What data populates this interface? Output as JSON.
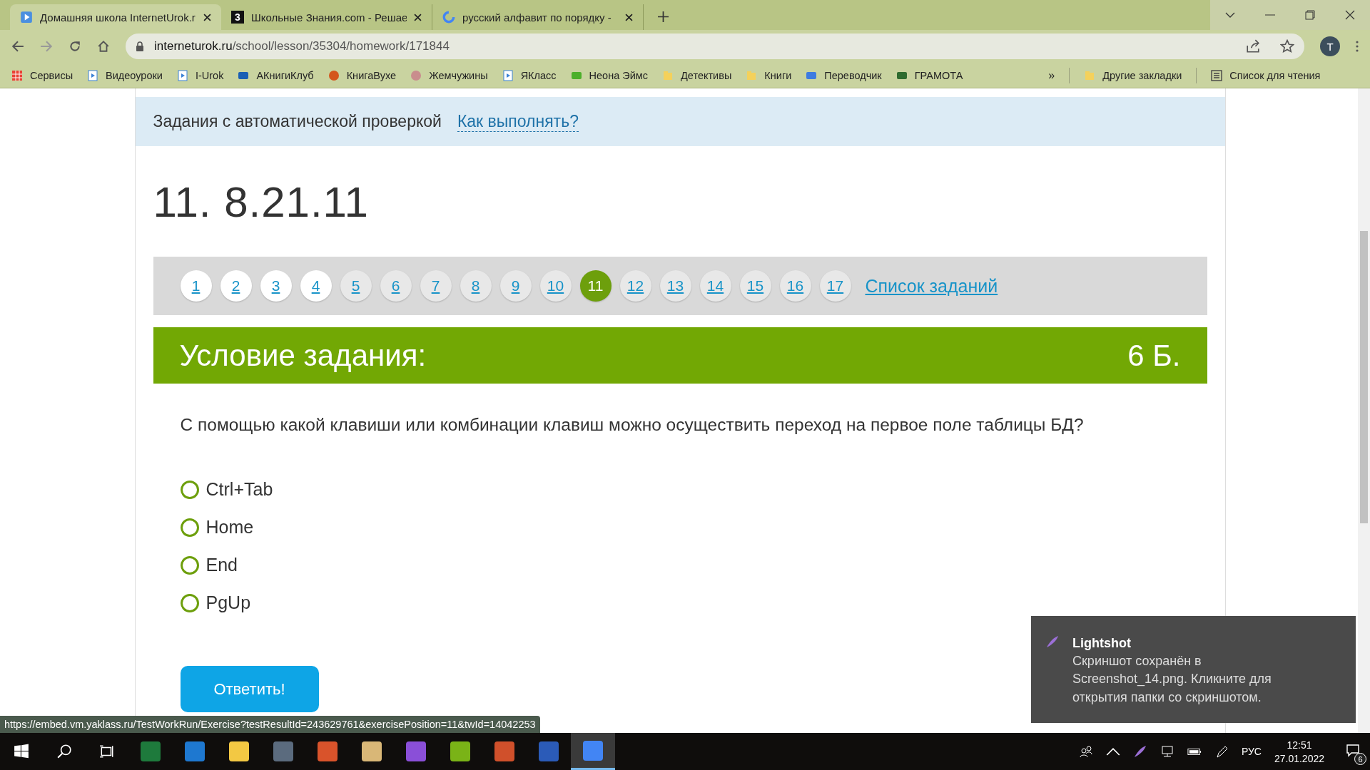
{
  "browser": {
    "tabs": [
      {
        "title": "Домашняя школа InternetUrok.r",
        "kind": "play",
        "selected": true
      },
      {
        "title": "Школьные Знания.com - Решае",
        "kind": "letter",
        "icon_text": "3",
        "selected": false
      },
      {
        "title": "русский алфавит по порядку -",
        "kind": "google",
        "selected": false
      }
    ],
    "address": {
      "domain": "interneturok.ru",
      "path": "/school/lesson/35304/homework/171844"
    },
    "profile": "T",
    "bookmarks": [
      {
        "label": "Сервисы",
        "kind": "grid"
      },
      {
        "label": "Видеоуроки",
        "kind": "play"
      },
      {
        "label": "I-Urok",
        "kind": "play"
      },
      {
        "label": "АКнигиКлуб",
        "kind": "megaphone"
      },
      {
        "label": "КнигаВухе",
        "kind": "badge"
      },
      {
        "label": "Жемчужины",
        "kind": "pearl"
      },
      {
        "label": "ЯКласс",
        "kind": "play"
      },
      {
        "label": "Неона Эймс",
        "kind": "book"
      },
      {
        "label": "Детективы",
        "kind": "folder"
      },
      {
        "label": "Книги",
        "kind": "folder"
      },
      {
        "label": "Переводчик",
        "kind": "translate"
      },
      {
        "label": "ГРАМОТА",
        "kind": "grass"
      }
    ],
    "overflow": "»",
    "other_bookmarks": "Другие закладки",
    "reading_list": "Список для чтения"
  },
  "page": {
    "header_band": {
      "title": "Задания с автоматической проверкой",
      "link": "Как выполнять?"
    },
    "task_number": "11. 8.21.11",
    "pagination": {
      "pages": [
        {
          "label": "1",
          "visited": true,
          "selected": false
        },
        {
          "label": "2",
          "visited": true,
          "selected": false
        },
        {
          "label": "3",
          "visited": true,
          "selected": false
        },
        {
          "label": "4",
          "visited": true,
          "selected": false
        },
        {
          "label": "5",
          "visited": false,
          "selected": false
        },
        {
          "label": "6",
          "visited": false,
          "selected": false
        },
        {
          "label": "7",
          "visited": false,
          "selected": false
        },
        {
          "label": "8",
          "visited": false,
          "selected": false
        },
        {
          "label": "9",
          "visited": false,
          "selected": false
        },
        {
          "label": "10",
          "visited": false,
          "selected": false
        },
        {
          "label": "11",
          "selected": true
        },
        {
          "label": "12",
          "visited": false,
          "selected": false
        },
        {
          "label": "13",
          "visited": false,
          "selected": false
        },
        {
          "label": "14",
          "visited": false,
          "selected": false
        },
        {
          "label": "15",
          "visited": false,
          "selected": false
        },
        {
          "label": "16",
          "visited": false,
          "selected": false
        },
        {
          "label": "17",
          "visited": false,
          "selected": false
        }
      ],
      "list_link": "Список заданий"
    },
    "task": {
      "heading": "Условие задания:",
      "points": "6 Б.",
      "question": "С помощью какой клавиши или комбинации клавиш можно осуществить переход на первое поле таблицы БД?",
      "options": [
        {
          "label": "Ctrl+Tab",
          "selected": false
        },
        {
          "label": "Home",
          "selected": false
        },
        {
          "label": "End",
          "selected": false
        },
        {
          "label": "PgUp",
          "selected": false
        }
      ],
      "submit": "Ответить!"
    }
  },
  "status_url": "https://embed.vm.yaklass.ru/TestWorkRun/Exercise?testResultId=243629761&exercisePosition=11&twId=14042253",
  "notification": {
    "app": "Lightshot",
    "message": "Скриншот сохранён в Screenshot_14.png. Кликните для открытия папки со скриншотом."
  },
  "taskbar": {
    "apps": [
      {
        "kind": "excel",
        "selected": false
      },
      {
        "kind": "edge",
        "selected": false
      },
      {
        "kind": "explorer",
        "selected": false
      },
      {
        "kind": "calculator",
        "selected": false
      },
      {
        "kind": "red-app",
        "selected": false
      },
      {
        "kind": "palette",
        "selected": false
      },
      {
        "kind": "drop",
        "selected": false
      },
      {
        "kind": "green-book",
        "selected": false
      },
      {
        "kind": "powerpoint",
        "selected": false
      },
      {
        "kind": "word",
        "selected": false
      },
      {
        "kind": "chrome",
        "selected": true
      }
    ],
    "language": "РУС",
    "time": "12:51",
    "date": "27.01.2022",
    "notification_count": "6"
  }
}
